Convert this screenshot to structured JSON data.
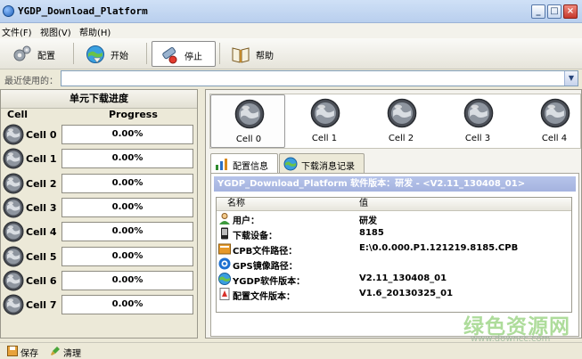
{
  "window": {
    "title": "YGDP_Download_Platform"
  },
  "menu": [
    "文件(F)",
    "视图(V)",
    "帮助(H)"
  ],
  "toolbar": {
    "config": "配置",
    "start": "开始",
    "stop": "停止",
    "help": "帮助"
  },
  "recent": {
    "label": "最近使用的：",
    "value": ""
  },
  "left_panel": {
    "title": "单元下载进度",
    "col_cell": "Cell",
    "col_progress": "Progress",
    "rows": [
      {
        "cell": "Cell 0",
        "progress": "0.00%"
      },
      {
        "cell": "Cell 1",
        "progress": "0.00%"
      },
      {
        "cell": "Cell 2",
        "progress": "0.00%"
      },
      {
        "cell": "Cell 3",
        "progress": "0.00%"
      },
      {
        "cell": "Cell 4",
        "progress": "0.00%"
      },
      {
        "cell": "Cell 5",
        "progress": "0.00%"
      },
      {
        "cell": "Cell 6",
        "progress": "0.00%"
      },
      {
        "cell": "Cell 7",
        "progress": "0.00%"
      }
    ]
  },
  "top_cells": [
    "Cell 0",
    "Cell 1",
    "Cell 2",
    "Cell 3",
    "Cell 4"
  ],
  "tabs": {
    "config_info": "配置信息",
    "download_log": "下载消息记录"
  },
  "info": {
    "banner": "YGDP_Download_Platform 软件版本：研发 - <V2.11_130408_01>",
    "col_name": "名称",
    "col_value": "值",
    "rows": [
      {
        "icon": "user-icon",
        "key": "用户：",
        "value": "研发"
      },
      {
        "icon": "phone-icon",
        "key": "下载设备：",
        "value": "8185"
      },
      {
        "icon": "folder-icon",
        "key": "CPB文件路径：",
        "value": "E:\\0.0.000.P1.121219.8185.CPB"
      },
      {
        "icon": "gps-icon",
        "key": "GPS镜像路径：",
        "value": ""
      },
      {
        "icon": "globe-icon",
        "key": "YGDP软件版本：",
        "value": "V2.11_130408_01"
      },
      {
        "icon": "file-icon",
        "key": "配置文件版本：",
        "value": "V1.6_20130325_01"
      }
    ]
  },
  "statusbar": {
    "save": "保存",
    "clear": "清理"
  },
  "watermark": {
    "cn": "绿色资源网",
    "url": "www.downcc.com"
  }
}
